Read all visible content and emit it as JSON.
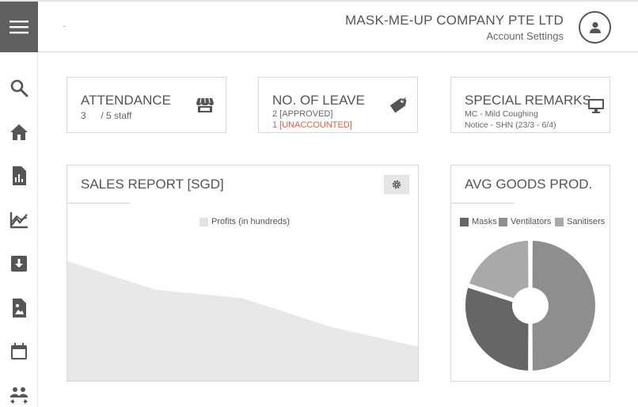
{
  "header": {
    "company_name": "MASK-ME-UP COMPANY PTE LTD",
    "account_link": "Account Settings"
  },
  "sidebar": {
    "items": [
      {
        "icon": "search-icon"
      },
      {
        "icon": "home-icon"
      },
      {
        "icon": "report-icon"
      },
      {
        "icon": "line-chart-icon"
      },
      {
        "icon": "download-box-icon"
      },
      {
        "icon": "image-file-icon"
      },
      {
        "icon": "calendar-icon"
      },
      {
        "icon": "people-icon"
      }
    ]
  },
  "cards": {
    "attendance": {
      "title": "ATTENDANCE",
      "present": "3",
      "total": "/ 5 staff",
      "icon": "store-icon"
    },
    "leave": {
      "title": "NO. OF LEAVE",
      "approved": "2 [APPROVED]",
      "unaccounted": "1 [UNACCOUNTED]",
      "icon": "tag-icon"
    },
    "remarks": {
      "title": "SPECIAL REMARKS",
      "line1": "MC - Mild Coughing",
      "line2": "Notice - SHN (23/3 - 6/4)",
      "icon": "monitor-icon"
    }
  },
  "colors": {
    "sidebar_active": "#5f5f5f",
    "area_fill": "#e8e8e8",
    "masks": "#666666",
    "ventilators": "#8e8e8e",
    "sanitisers": "#a9a9a9",
    "alert": "#e0623f"
  },
  "sales_report": {
    "title": "SALES REPORT [SGD]",
    "settings_icon": "gear-icon",
    "chart_data": {
      "type": "area",
      "series": [
        {
          "name": "Profits (in hundreds)",
          "values": [
            84,
            64,
            58,
            38,
            24
          ]
        }
      ],
      "ylim": [
        0,
        100
      ]
    }
  },
  "avg_goods": {
    "title": "AVG GOODS PROD.",
    "chart_data": {
      "type": "pie",
      "labels": [
        "Masks",
        "Ventilators",
        "Sanitisers"
      ],
      "values": [
        30,
        50,
        20
      ]
    }
  }
}
